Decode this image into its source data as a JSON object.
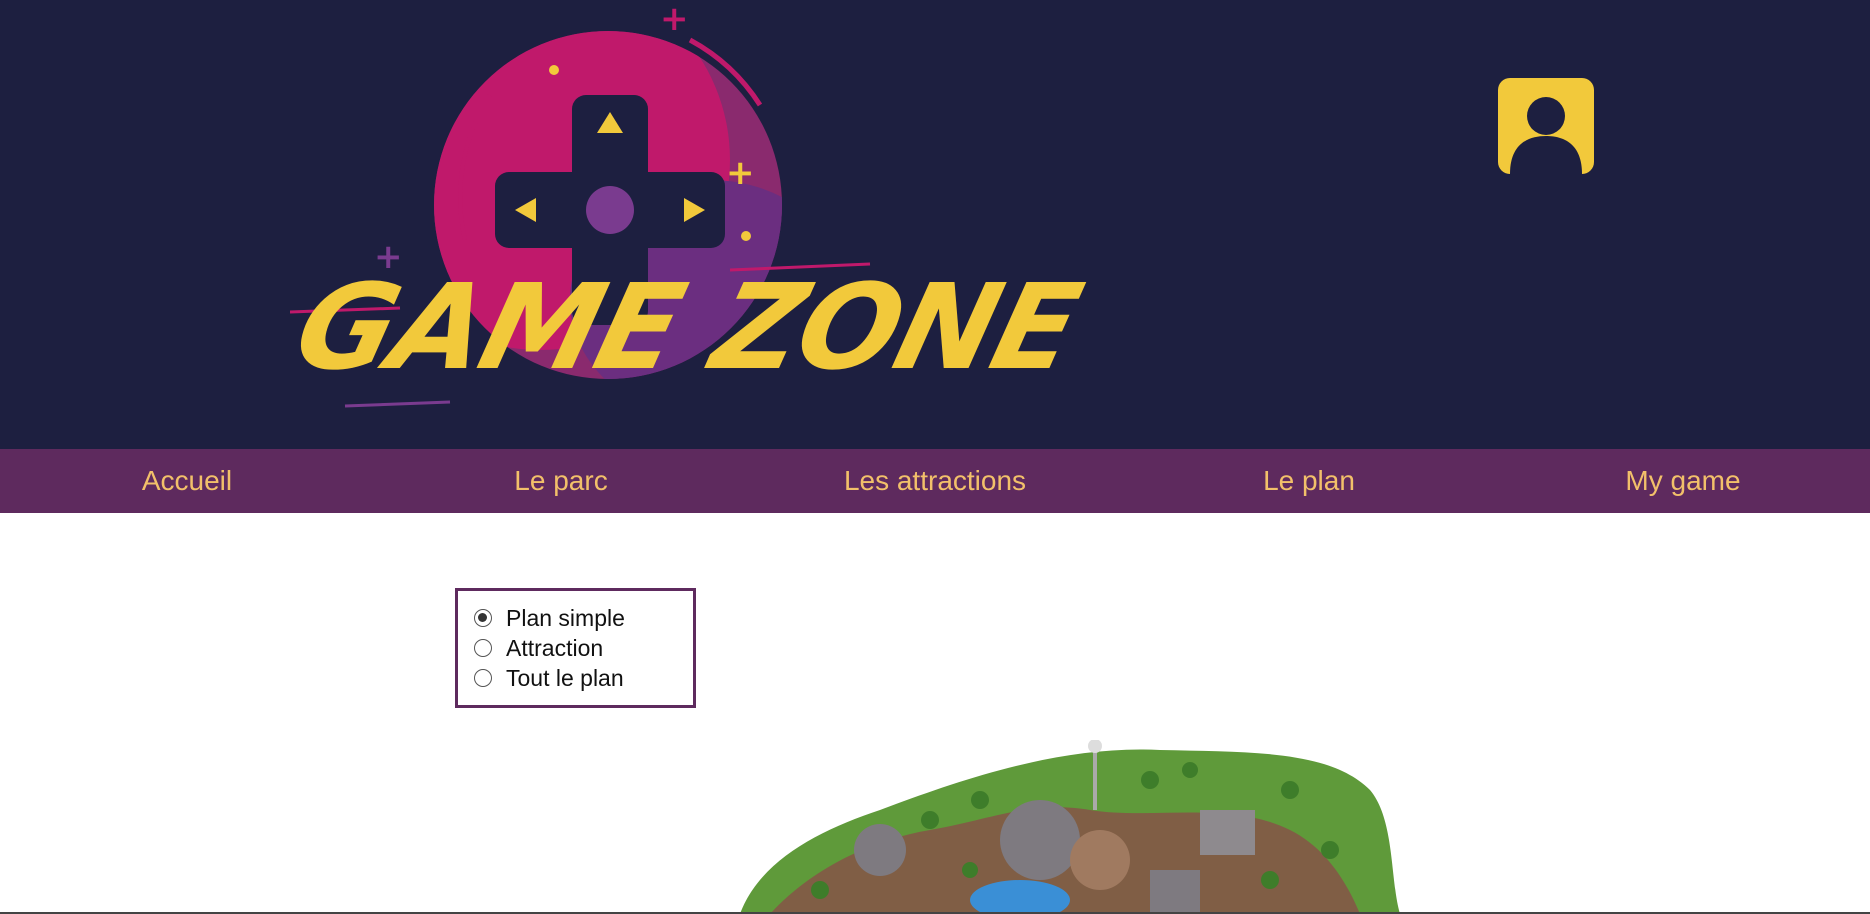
{
  "header": {
    "logo_text": "GAME ZONE",
    "logo_icon": "gamepad-dpad-icon",
    "account_icon": "user-avatar-icon"
  },
  "nav": {
    "items": [
      "Accueil",
      "Le parc",
      "Les attractions",
      "Le plan",
      "My game"
    ]
  },
  "plan_options": {
    "selected": "Plan simple",
    "items": [
      "Plan simple",
      "Attraction",
      "Tout le plan"
    ]
  },
  "colors": {
    "header_bg": "#1d1f40",
    "nav_bg": "#5e2a5e",
    "nav_text": "#f2c06a",
    "accent_yellow": "#f2c93b",
    "accent_magenta": "#c0196b",
    "accent_purple": "#7a3b8f"
  }
}
